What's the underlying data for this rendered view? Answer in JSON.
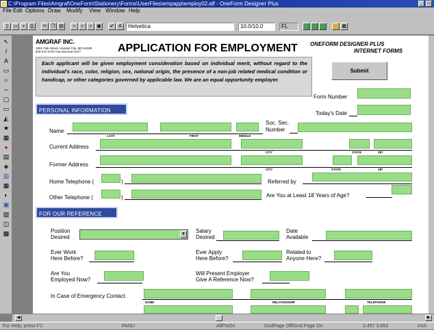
{
  "window": {
    "title": "C:\\Program Files\\Amgraf\\OneForm\\Stationery\\Forms\\UserFiles\\empapp\\employ02.elf - OneForm Designer Plus",
    "buttons": [
      "_",
      "□"
    ]
  },
  "menu": [
    "File",
    "Edit",
    "Options",
    "Draw",
    "Modify",
    "View",
    "Window",
    "Help"
  ],
  "toolbar": {
    "font_name": "Helvetica",
    "font_size": "10.0/10.0",
    "align": "FL"
  },
  "tools": [
    "↖",
    "/",
    "A",
    "▭",
    "○",
    "∼",
    "▢",
    "▭",
    "◭",
    "★",
    "▦",
    "●",
    "▤",
    "◈",
    "▥",
    "▦",
    "◐",
    "▣",
    "▧",
    "◫",
    "▩"
  ],
  "header": {
    "company": "AMGRAF INC.",
    "address_line1": "1501 Oak Street, Kansas City, MO 64108",
    "address_line2": "816-474-4797  Fax 816-842-4477",
    "form_title": "APPLICATION FOR EMPLOYMENT",
    "brand_line1": "ONEFORM DESIGNER PLUS",
    "brand_line2": "INTERNET FORMS"
  },
  "notice": "Each applicant will be given employment consideration based on individual merit, without regard to the individual's race, color, religion, sex, national origin, the presence of a non-job related medical condition or handicap, or other categories governed by applicable law. We are an equal opportunity employer.",
  "submit_label": "Submit",
  "form_number_label": "Form Number",
  "todays_date_label": "Today's Date",
  "personal": {
    "section_title": "PERSONAL INFORMATION",
    "name_label": "Name",
    "last": "LAST",
    "first": "FIRST",
    "middle": "MIDDLE",
    "ssn_label_1": "Soc. Sec.",
    "ssn_label_2": "Number",
    "current_address_label": "Current Address",
    "former_address_label": "Former Address",
    "city": "CITY",
    "state": "STATE",
    "zip": "ZIP",
    "home_phone_label": "Home Telephone (",
    "other_phone_label": "Other Telephone (",
    "paren_close": ")",
    "referred_by_label": "Referred by",
    "age_label": "Are You at Least 18 Years of Age?"
  },
  "reference": {
    "section_title": "FOR OUR REFERENCE",
    "position_label_1": "Position",
    "position_label_2": "Desired",
    "salary_label_1": "Salary",
    "salary_label_2": "Desired",
    "date_label_1": "Date",
    "date_label_2": "Available",
    "ever_work_1": "Ever Work",
    "ever_work_2": "Here Before?",
    "ever_apply_1": "Ever Apply",
    "ever_apply_2": "Here Before?",
    "related_1": "Related to",
    "related_2": "Anyone Here?",
    "employed_1": "Are You",
    "employed_2": "Employed Now?",
    "present_employer_1": "Will Present Employer",
    "present_employer_2": "Give A Reference Now?",
    "emergency_label": "In Case of Emergency Contact",
    "name": "NAME",
    "relationship": "RELATIONSHIP",
    "telephone": "TELEPHONE"
  },
  "status": {
    "help": "For Help, press F1",
    "pan": "PANU",
    "snap": "AllPtsOn",
    "grid": "GridPage Off/Grid Page On",
    "coords": "3.457  3.853",
    "mode": "Inch"
  }
}
